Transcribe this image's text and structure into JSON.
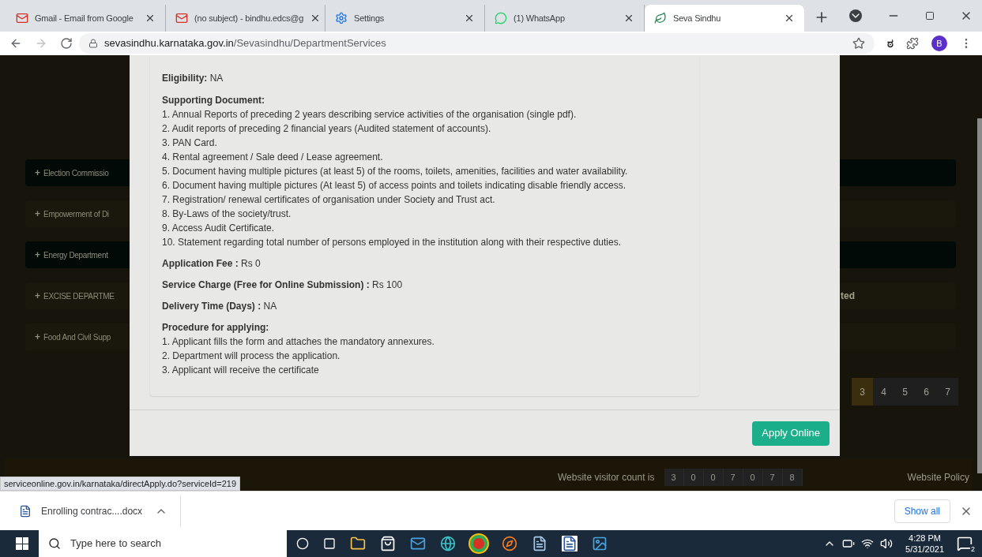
{
  "browser": {
    "tabs": [
      {
        "title": "Gmail - Email from Google",
        "kind": "mail",
        "selected": false
      },
      {
        "title": "(no subject) - bindhu.edcs@g",
        "kind": "mail",
        "selected": false
      },
      {
        "title": "Settings",
        "kind": "gear",
        "selected": false
      },
      {
        "title": "(1) WhatsApp",
        "kind": "chat",
        "selected": false
      },
      {
        "title": "Seva Sindhu",
        "kind": "leaf",
        "selected": true
      }
    ],
    "url_host": "sevasindhu.karnataka.gov.in",
    "url_path": "/Sevasindhu/DepartmentServices",
    "extension_letter": "ಠ",
    "profile_letter": "B"
  },
  "page": {
    "departments": [
      {
        "symbol": "+",
        "label": "Election Commissio",
        "color": "#020a08"
      },
      {
        "symbol": "+",
        "label": "Empowerment of Di",
        "color": "#1a170c"
      },
      {
        "symbol": "+",
        "label": "Energy Department",
        "color": "#020a08"
      },
      {
        "symbol": "+",
        "label": "EXCISE DEPARTME",
        "color": "#1a170c",
        "right_text": "ted"
      },
      {
        "symbol": "+",
        "label": "Food And Civil Supp",
        "color": "#1a170c"
      }
    ],
    "pagination": [
      {
        "label": "3",
        "selected": true
      },
      {
        "label": "4",
        "selected": false
      },
      {
        "label": "5",
        "selected": false
      },
      {
        "label": "6",
        "selected": false
      },
      {
        "label": "7",
        "selected": false
      }
    ],
    "visitor_label": "Website visitor count is",
    "visitor_digits": [
      "3",
      "0",
      "0",
      "7",
      "0",
      "7",
      "8"
    ],
    "footer_link": "Website Policy"
  },
  "modal": {
    "eligibility_label": "Eligibility:",
    "eligibility_value": "NA",
    "documents_title": "Supporting Document:",
    "documents": [
      "1. Annual Reports of preceding 2 years describing service activities of the organisation (single pdf).",
      "2. Audit reports of preceding 2 financial years (Audited statement of accounts).",
      "3. PAN Card.",
      "4. Rental agreement / Sale deed / Lease agreement.",
      "5. Document having multiple pictures (at least 5) of the rooms, toilets, amenities, facilities and water availability.",
      "6. Document having multiple pictures (At least 5) of access points and toilets indicating disable friendly access.",
      "7. Registration/ renewal certificates of organisation under Society and Trust act.",
      "8. By-Laws of the society/trust.",
      "9. Access Audit Certificate.",
      "10. Statement regarding total number of persons employed in the institution along with their respective duties."
    ],
    "fields": [
      {
        "label": "Application Fee :",
        "value": "Rs 0"
      },
      {
        "label": "Service Charge (Free for Online Submission) :",
        "value": "Rs 100"
      },
      {
        "label": "Delivery Time (Days) :",
        "value": "NA"
      }
    ],
    "procedure_title": "Procedure for applying:",
    "procedure": [
      "1. Applicant fills the form and attaches the mandatory annexures.",
      "2. Department will process the application.",
      "3. Applicant will receive the certificate"
    ],
    "apply_button": "Apply Online"
  },
  "status_url": "serviceonline.gov.in/karnataka/directApply.do?serviceId=219",
  "downloads": {
    "file": "Enrolling contrac....docx",
    "show_all": "Show all"
  },
  "taskbar": {
    "search_placeholder": "Type here to search",
    "time": "4:28 PM",
    "date": "5/31/2021",
    "notifications": "2"
  }
}
